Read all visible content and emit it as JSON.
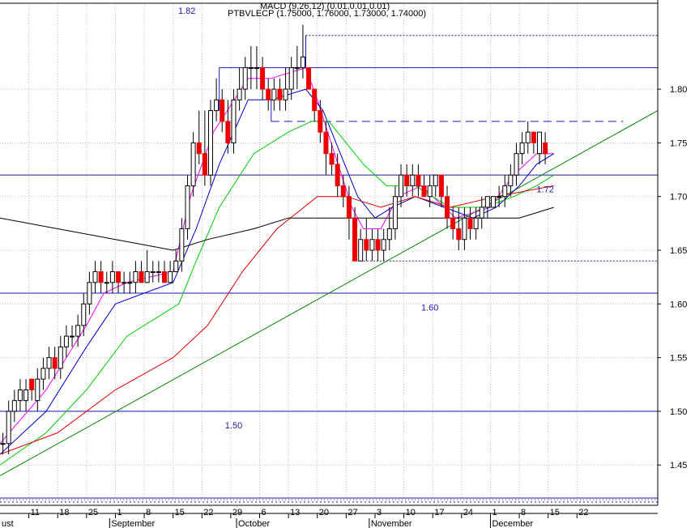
{
  "chart_data": {
    "type": "candlestick",
    "title": "PTBVLECP (1.75000, 1.76000, 1.73000, 1.74000)",
    "overlay_label": "MACD (9,26,12) (0.01,0.01,0.01)",
    "top_value_label": "1.82",
    "ylim": [
      1.42,
      1.88
    ],
    "x_range": [
      0,
      114
    ],
    "y_ticks": [
      "1.80",
      "1.75",
      "1.70",
      "1.65",
      "1.60",
      "1.55",
      "1.50",
      "1.45"
    ],
    "y_tick_values": [
      1.8,
      1.75,
      1.7,
      1.65,
      1.6,
      1.55,
      1.5,
      1.45
    ],
    "x_day_ticks": [
      {
        "label": "11",
        "x": 5
      },
      {
        "label": "18",
        "x": 10
      },
      {
        "label": "25",
        "x": 15
      },
      {
        "label": "1",
        "x": 20
      },
      {
        "label": "8",
        "x": 25
      },
      {
        "label": "15",
        "x": 30
      },
      {
        "label": "22",
        "x": 35
      },
      {
        "label": "29",
        "x": 40
      },
      {
        "label": "6",
        "x": 45
      },
      {
        "label": "13",
        "x": 50
      },
      {
        "label": "20",
        "x": 55
      },
      {
        "label": "27",
        "x": 60
      },
      {
        "label": "3",
        "x": 65
      },
      {
        "label": "10",
        "x": 70
      },
      {
        "label": "17",
        "x": 75
      },
      {
        "label": "24",
        "x": 80
      },
      {
        "label": "1",
        "x": 85
      },
      {
        "label": "8",
        "x": 90
      },
      {
        "label": "15",
        "x": 95
      },
      {
        "label": "22",
        "x": 100
      }
    ],
    "x_month_labels": [
      {
        "label": "ust",
        "x": 0
      },
      {
        "label": "September",
        "x": 19
      },
      {
        "label": "October",
        "x": 41
      },
      {
        "label": "November",
        "x": 64
      },
      {
        "label": "December",
        "x": 85
      }
    ],
    "candles": [
      [
        1.47,
        1.48,
        1.46,
        1.47
      ],
      [
        1.47,
        1.51,
        1.46,
        1.5
      ],
      [
        1.5,
        1.52,
        1.49,
        1.51
      ],
      [
        1.51,
        1.53,
        1.5,
        1.52
      ],
      [
        1.51,
        1.53,
        1.5,
        1.52
      ],
      [
        1.53,
        1.53,
        1.51,
        1.52
      ],
      [
        1.51,
        1.54,
        1.5,
        1.53
      ],
      [
        1.53,
        1.55,
        1.52,
        1.54
      ],
      [
        1.54,
        1.56,
        1.53,
        1.55
      ],
      [
        1.55,
        1.56,
        1.53,
        1.54
      ],
      [
        1.54,
        1.57,
        1.53,
        1.56
      ],
      [
        1.56,
        1.58,
        1.55,
        1.57
      ],
      [
        1.57,
        1.58,
        1.56,
        1.57
      ],
      [
        1.57,
        1.59,
        1.56,
        1.58
      ],
      [
        1.58,
        1.61,
        1.57,
        1.6
      ],
      [
        1.6,
        1.63,
        1.59,
        1.62
      ],
      [
        1.62,
        1.64,
        1.61,
        1.63
      ],
      [
        1.63,
        1.64,
        1.61,
        1.62
      ],
      [
        1.62,
        1.63,
        1.61,
        1.62
      ],
      [
        1.62,
        1.64,
        1.61,
        1.63
      ],
      [
        1.63,
        1.63,
        1.61,
        1.62
      ],
      [
        1.62,
        1.63,
        1.61,
        1.62
      ],
      [
        1.62,
        1.63,
        1.61,
        1.62
      ],
      [
        1.62,
        1.64,
        1.61,
        1.63
      ],
      [
        1.63,
        1.64,
        1.62,
        1.62
      ],
      [
        1.62,
        1.65,
        1.62,
        1.63
      ],
      [
        1.63,
        1.64,
        1.62,
        1.63
      ],
      [
        1.63,
        1.64,
        1.62,
        1.63
      ],
      [
        1.63,
        1.64,
        1.62,
        1.62
      ],
      [
        1.62,
        1.64,
        1.62,
        1.63
      ],
      [
        1.63,
        1.65,
        1.63,
        1.64
      ],
      [
        1.64,
        1.68,
        1.63,
        1.67
      ],
      [
        1.67,
        1.72,
        1.66,
        1.71
      ],
      [
        1.71,
        1.76,
        1.7,
        1.75
      ],
      [
        1.75,
        1.78,
        1.73,
        1.74
      ],
      [
        1.74,
        1.78,
        1.71,
        1.72
      ],
      [
        1.72,
        1.79,
        1.71,
        1.78
      ],
      [
        1.78,
        1.81,
        1.77,
        1.79
      ],
      [
        1.79,
        1.8,
        1.76,
        1.77
      ],
      [
        1.77,
        1.79,
        1.74,
        1.75
      ],
      [
        1.75,
        1.8,
        1.74,
        1.79
      ],
      [
        1.79,
        1.82,
        1.78,
        1.8
      ],
      [
        1.8,
        1.83,
        1.79,
        1.82
      ],
      [
        1.82,
        1.84,
        1.8,
        1.82
      ],
      [
        1.82,
        1.84,
        1.8,
        1.82
      ],
      [
        1.82,
        1.83,
        1.79,
        1.8
      ],
      [
        1.8,
        1.81,
        1.78,
        1.79
      ],
      [
        1.79,
        1.81,
        1.78,
        1.8
      ],
      [
        1.8,
        1.81,
        1.78,
        1.79
      ],
      [
        1.79,
        1.82,
        1.78,
        1.8
      ],
      [
        1.8,
        1.83,
        1.79,
        1.82
      ],
      [
        1.82,
        1.84,
        1.8,
        1.82
      ],
      [
        1.82,
        1.86,
        1.81,
        1.83
      ],
      [
        1.82,
        1.82,
        1.8,
        1.8
      ],
      [
        1.8,
        1.8,
        1.77,
        1.78
      ],
      [
        1.78,
        1.79,
        1.75,
        1.76
      ],
      [
        1.76,
        1.77,
        1.72,
        1.74
      ],
      [
        1.74,
        1.75,
        1.72,
        1.73
      ],
      [
        1.73,
        1.74,
        1.7,
        1.71
      ],
      [
        1.71,
        1.72,
        1.69,
        1.7
      ],
      [
        1.7,
        1.71,
        1.66,
        1.68
      ],
      [
        1.68,
        1.69,
        1.64,
        1.64
      ],
      [
        1.64,
        1.67,
        1.64,
        1.66
      ],
      [
        1.66,
        1.68,
        1.64,
        1.65
      ],
      [
        1.65,
        1.67,
        1.64,
        1.66
      ],
      [
        1.66,
        1.67,
        1.64,
        1.65
      ],
      [
        1.65,
        1.67,
        1.64,
        1.66
      ],
      [
        1.66,
        1.69,
        1.65,
        1.67
      ],
      [
        1.67,
        1.71,
        1.66,
        1.7
      ],
      [
        1.7,
        1.73,
        1.69,
        1.72
      ],
      [
        1.72,
        1.73,
        1.7,
        1.71
      ],
      [
        1.71,
        1.73,
        1.7,
        1.72
      ],
      [
        1.72,
        1.73,
        1.7,
        1.71
      ],
      [
        1.71,
        1.72,
        1.7,
        1.7
      ],
      [
        1.7,
        1.72,
        1.69,
        1.71
      ],
      [
        1.71,
        1.72,
        1.7,
        1.72
      ],
      [
        1.72,
        1.72,
        1.69,
        1.7
      ],
      [
        1.7,
        1.71,
        1.67,
        1.68
      ],
      [
        1.68,
        1.69,
        1.66,
        1.67
      ],
      [
        1.67,
        1.69,
        1.65,
        1.66
      ],
      [
        1.66,
        1.69,
        1.65,
        1.68
      ],
      [
        1.68,
        1.69,
        1.66,
        1.67
      ],
      [
        1.67,
        1.69,
        1.66,
        1.68
      ],
      [
        1.68,
        1.7,
        1.67,
        1.69
      ],
      [
        1.69,
        1.7,
        1.68,
        1.7
      ],
      [
        1.69,
        1.7,
        1.69,
        1.7
      ],
      [
        1.7,
        1.71,
        1.69,
        1.7
      ],
      [
        1.7,
        1.72,
        1.69,
        1.71
      ],
      [
        1.71,
        1.73,
        1.7,
        1.72
      ],
      [
        1.72,
        1.75,
        1.71,
        1.74
      ],
      [
        1.74,
        1.76,
        1.73,
        1.75
      ],
      [
        1.75,
        1.77,
        1.74,
        1.76
      ],
      [
        1.76,
        1.76,
        1.74,
        1.75
      ],
      [
        1.74,
        1.76,
        1.73,
        1.76
      ],
      [
        1.75,
        1.76,
        1.73,
        1.74
      ]
    ],
    "series": [
      {
        "color": "#ff00ff",
        "points": [
          [
            0,
            1.47
          ],
          [
            8,
            1.52
          ],
          [
            15,
            1.58
          ],
          [
            18,
            1.61
          ],
          [
            22,
            1.62
          ],
          [
            30,
            1.63
          ],
          [
            33,
            1.7
          ],
          [
            37,
            1.76
          ],
          [
            43,
            1.81
          ],
          [
            47,
            1.81
          ],
          [
            53,
            1.82
          ],
          [
            55,
            1.79
          ],
          [
            58,
            1.74
          ],
          [
            61,
            1.69
          ],
          [
            63,
            1.67
          ],
          [
            66,
            1.67
          ],
          [
            69,
            1.7
          ],
          [
            73,
            1.71
          ],
          [
            79,
            1.68
          ],
          [
            85,
            1.69
          ],
          [
            89,
            1.72
          ],
          [
            93,
            1.74
          ],
          [
            96,
            1.74
          ]
        ]
      },
      {
        "color": "#0000cc",
        "points": [
          [
            0,
            1.46
          ],
          [
            8,
            1.5
          ],
          [
            15,
            1.56
          ],
          [
            20,
            1.6
          ],
          [
            25,
            1.61
          ],
          [
            30,
            1.62
          ],
          [
            34,
            1.67
          ],
          [
            38,
            1.73
          ],
          [
            43,
            1.79
          ],
          [
            47,
            1.79
          ],
          [
            53,
            1.8
          ],
          [
            56,
            1.78
          ],
          [
            59,
            1.74
          ],
          [
            62,
            1.7
          ],
          [
            65,
            1.68
          ],
          [
            68,
            1.69
          ],
          [
            72,
            1.7
          ],
          [
            77,
            1.69
          ],
          [
            82,
            1.68
          ],
          [
            86,
            1.69
          ],
          [
            90,
            1.71
          ],
          [
            93,
            1.73
          ],
          [
            96,
            1.74
          ]
        ]
      },
      {
        "color": "#00cc00",
        "points": [
          [
            0,
            1.45
          ],
          [
            8,
            1.48
          ],
          [
            15,
            1.52
          ],
          [
            22,
            1.57
          ],
          [
            28,
            1.59
          ],
          [
            31,
            1.6
          ],
          [
            34,
            1.64
          ],
          [
            38,
            1.69
          ],
          [
            44,
            1.74
          ],
          [
            50,
            1.76
          ],
          [
            54,
            1.77
          ],
          [
            57,
            1.77
          ],
          [
            60,
            1.75
          ],
          [
            63,
            1.73
          ],
          [
            67,
            1.71
          ],
          [
            72,
            1.71
          ],
          [
            78,
            1.69
          ],
          [
            84,
            1.69
          ],
          [
            89,
            1.7
          ],
          [
            93,
            1.71
          ],
          [
            96,
            1.72
          ]
        ]
      },
      {
        "color": "#dd0000",
        "points": [
          [
            0,
            1.46
          ],
          [
            10,
            1.48
          ],
          [
            20,
            1.52
          ],
          [
            30,
            1.55
          ],
          [
            36,
            1.58
          ],
          [
            42,
            1.63
          ],
          [
            48,
            1.67
          ],
          [
            55,
            1.7
          ],
          [
            60,
            1.7
          ],
          [
            66,
            1.69
          ],
          [
            72,
            1.7
          ],
          [
            78,
            1.69
          ],
          [
            86,
            1.7
          ],
          [
            96,
            1.71
          ]
        ]
      },
      {
        "color": "#000000",
        "points": [
          [
            0,
            1.68
          ],
          [
            10,
            1.67
          ],
          [
            20,
            1.66
          ],
          [
            30,
            1.65
          ],
          [
            36,
            1.66
          ],
          [
            44,
            1.67
          ],
          [
            50,
            1.68
          ],
          [
            56,
            1.68
          ],
          [
            62,
            1.68
          ],
          [
            70,
            1.68
          ],
          [
            80,
            1.68
          ],
          [
            90,
            1.68
          ],
          [
            96,
            1.69
          ]
        ]
      }
    ],
    "h_lines": [
      {
        "y": 1.72,
        "x0": 0,
        "x1": 114
      },
      {
        "y": 1.61,
        "x0": 0,
        "x1": 114
      },
      {
        "y": 1.5,
        "x0": 0,
        "x1": 114
      },
      {
        "y": 1.82,
        "x0": 38,
        "x1": 114
      },
      {
        "y": 1.64,
        "x0": 63,
        "x1": 114,
        "dotted": true
      },
      {
        "y": 1.85,
        "x0": 53,
        "x1": 114,
        "dotted": true
      }
    ],
    "dashed_level": {
      "y": 1.77,
      "x0": 47,
      "x1": 108
    },
    "trend_line": {
      "x0": 0,
      "y0": 1.44,
      "x1": 114,
      "y1": 1.78
    },
    "level_labels": [
      {
        "text": "1.72",
        "x": 93,
        "y": 1.704
      },
      {
        "text": "1.60",
        "x": 73,
        "y": 1.594
      },
      {
        "text": "1.50",
        "x": 39,
        "y": 1.484
      }
    ]
  }
}
